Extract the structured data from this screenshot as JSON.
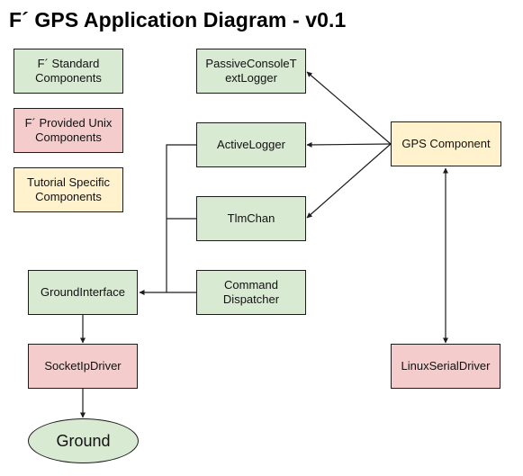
{
  "title": "F´ GPS Application Diagram - v0.1",
  "legend": {
    "standard": "F´ Standard Components",
    "unix": "F´ Provided Unix Components",
    "tutorial": "Tutorial Specific Components"
  },
  "colors": {
    "standard": "#d9ead3",
    "unix": "#f4cccc",
    "tutorial": "#fff2cc",
    "line": "#1c1c1c"
  },
  "nodes": {
    "passive_console": "PassiveConsoleT extLogger",
    "active_logger": "ActiveLogger",
    "tlm_chan": "TlmChan",
    "command_dispatcher": "Command Dispatcher",
    "gps": "GPS Component",
    "ground_interface": "GroundInterface",
    "socket_ip_driver": "SocketIpDriver",
    "linux_serial_driver": "LinuxSerialDriver",
    "ground": "Ground"
  },
  "connections": [
    {
      "from": "GPS Component",
      "to": "PassiveConsoleTextLogger",
      "type": "arrow"
    },
    {
      "from": "GPS Component",
      "to": "ActiveLogger",
      "type": "arrow"
    },
    {
      "from": "GPS Component",
      "to": "TlmChan",
      "type": "arrow"
    },
    {
      "from": "ActiveLogger",
      "to": "GroundInterface",
      "type": "arrow"
    },
    {
      "from": "TlmChan",
      "to": "GroundInterface",
      "type": "arrow"
    },
    {
      "from": "Command Dispatcher",
      "to": "GroundInterface",
      "type": "arrow"
    },
    {
      "from": "GroundInterface",
      "to": "SocketIpDriver",
      "type": "arrow"
    },
    {
      "from": "SocketIpDriver",
      "to": "Ground",
      "type": "arrow"
    },
    {
      "from": "GPS Component",
      "to": "LinuxSerialDriver",
      "type": "bidirectional"
    }
  ]
}
